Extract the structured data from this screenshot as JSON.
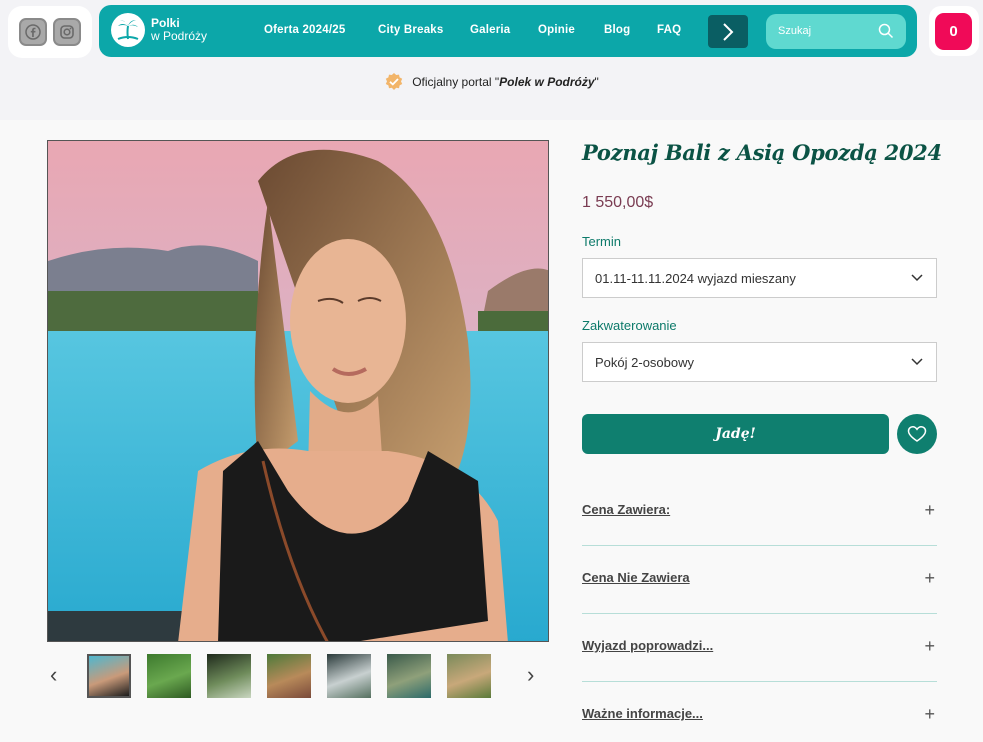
{
  "header": {
    "logo": {
      "line1": "Polki",
      "line2": "w Podróży"
    },
    "nav": [
      "Oferta 2024/25",
      "City Breaks",
      "Galeria",
      "Opinie",
      "Blog",
      "FAQ"
    ],
    "search_placeholder": "Szukaj",
    "cart_count": "0",
    "official_prefix": "Oficjalny portal \"",
    "official_brand": "Polek w Podróży",
    "official_suffix": "\""
  },
  "product": {
    "title": "Poznaj Bali z Asią Opozdą 2024",
    "price": "1 550,00$",
    "term_label": "Termin",
    "term_value": "01.11-11.11.2024 wyjazd mieszany",
    "accommodation_label": "Zakwaterowanie",
    "accommodation_value": "Pokój 2-osobowy",
    "go_button": "Jadę!"
  },
  "accordion": [
    "Cena Zawiera:",
    "Cena Nie Zawiera",
    "Wyjazd poprowadzi...",
    "Ważne informacje..."
  ],
  "gallery": {
    "prev": "‹",
    "next": "›",
    "thumbnails": [
      {
        "colors": [
          "#4fb7cf",
          "#c99a7a",
          "#1d1d1d"
        ]
      },
      {
        "colors": [
          "#3d7a2e",
          "#6aa84f",
          "#2e5a22"
        ]
      },
      {
        "colors": [
          "#1f2a1c",
          "#6f8c5b",
          "#c9d6c0"
        ]
      },
      {
        "colors": [
          "#4d7a3a",
          "#b88a5a",
          "#7a4a3a"
        ]
      },
      {
        "colors": [
          "#2a3a3a",
          "#c8d0d0",
          "#55705f"
        ]
      },
      {
        "colors": [
          "#3a5a4a",
          "#8fa07a",
          "#2c6a6a"
        ]
      },
      {
        "colors": [
          "#7a8a5a",
          "#c8a87a",
          "#5a7a3a"
        ]
      }
    ]
  },
  "colors": {
    "brand_teal": "#0ca7a9",
    "dark_green": "#0f7f6f",
    "cart_pink": "#f00a58",
    "price": "#7a3c52"
  }
}
